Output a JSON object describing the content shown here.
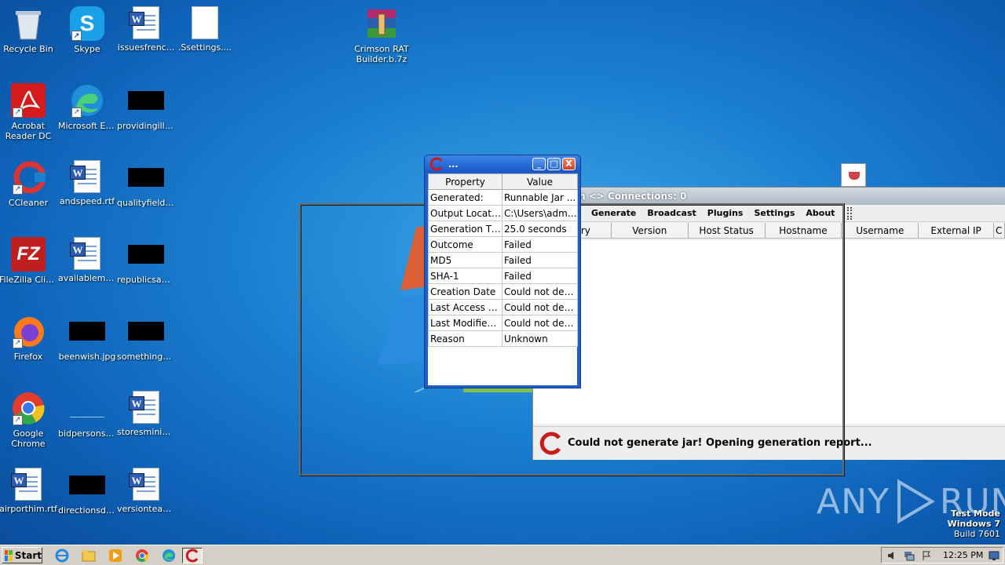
{
  "desktop_icons": [
    {
      "name": "recycle-bin-icon",
      "label": "Recycle Bin"
    },
    {
      "name": "skype-icon",
      "label": "Skype"
    },
    {
      "name": "word-doc-icon",
      "label": "issuesfrenc..."
    },
    {
      "name": "blank-file-icon",
      "label": ".Ssettings...."
    },
    {
      "name": "winrar-archive-icon",
      "label": "Crimson RAT Builder.b.7z"
    },
    {
      "name": "acrobat-reader-icon",
      "label": "Acrobat Reader DC"
    },
    {
      "name": "edge-icon",
      "label": "Microsoft Edge"
    },
    {
      "name": "redacted-thumbnail-icon",
      "label": "providingillin..."
    },
    {
      "name": "ccleaner-icon",
      "label": "CCleaner"
    },
    {
      "name": "word-doc-icon",
      "label": "andspeed.rtf"
    },
    {
      "name": "redacted-thumbnail-icon",
      "label": "qualityfields..."
    },
    {
      "name": "filezilla-icon",
      "label": "FileZilla Client"
    },
    {
      "name": "word-doc-icon",
      "label": "availablema..."
    },
    {
      "name": "redacted-thumbnail-icon",
      "label": "republicsam..."
    },
    {
      "name": "firefox-icon",
      "label": "Firefox"
    },
    {
      "name": "redacted-thumbnail-icon",
      "label": "beenwish.jpg"
    },
    {
      "name": "redacted-thumbnail-icon",
      "label": "somethingp..."
    },
    {
      "name": "chrome-icon",
      "label": "Google Chrome"
    },
    {
      "name": "blank-thumbnail-icon",
      "label": "bidpersons...."
    },
    {
      "name": "word-doc-icon",
      "label": "storesminist..."
    },
    {
      "name": "word-doc-icon",
      "label": "airporthim.rtf"
    },
    {
      "name": "redacted-thumbnail-icon",
      "label": "directionsdi..."
    },
    {
      "name": "word-doc-icon",
      "label": "versionteam..."
    }
  ],
  "main_window": {
    "title": "n <> Connections: 0",
    "menu": [
      "Generate",
      "Broadcast",
      "Plugins",
      "Settings",
      "About"
    ],
    "columns": [
      "try",
      "Version",
      "Host Status",
      "Hostname",
      "Username",
      "External IP",
      "C"
    ],
    "status_message": "Could not generate jar! Opening generation report..."
  },
  "report_window": {
    "title": "...",
    "headers": [
      "Property",
      "Value"
    ],
    "rows": [
      [
        "Generated:",
        "Runnable Jar ..."
      ],
      [
        "Output Location:",
        "C:\\Users\\admi..."
      ],
      [
        "Generation Ti...",
        "25.0 seconds"
      ],
      [
        "Outcome",
        "Failed"
      ],
      [
        "MD5",
        "Failed"
      ],
      [
        "SHA-1",
        "Failed"
      ],
      [
        "Creation Date",
        "Could not dete..."
      ],
      [
        "Last Access D...",
        "Could not dete..."
      ],
      [
        "Last Modified ...",
        "Could not dete..."
      ],
      [
        "Reason",
        "Unknown"
      ]
    ],
    "buttons": {
      "minimize": "_",
      "maximize": "□",
      "close": "X"
    }
  },
  "watermark": {
    "left": "ANY",
    "right": "RUN"
  },
  "system_info": {
    "mode": "Test Mode",
    "os": "Windows 7",
    "build": "Build 7601"
  },
  "taskbar": {
    "start_label": "Start",
    "clock": "12:25 PM",
    "pinned": [
      "internet-explorer-icon",
      "explorer-folder-icon",
      "media-player-icon",
      "chrome-icon",
      "edge-icon",
      "crimson-rat-icon"
    ]
  },
  "colors": {
    "accent_red": "#cc1a1a",
    "titlebar_blue": "#1856c6"
  }
}
